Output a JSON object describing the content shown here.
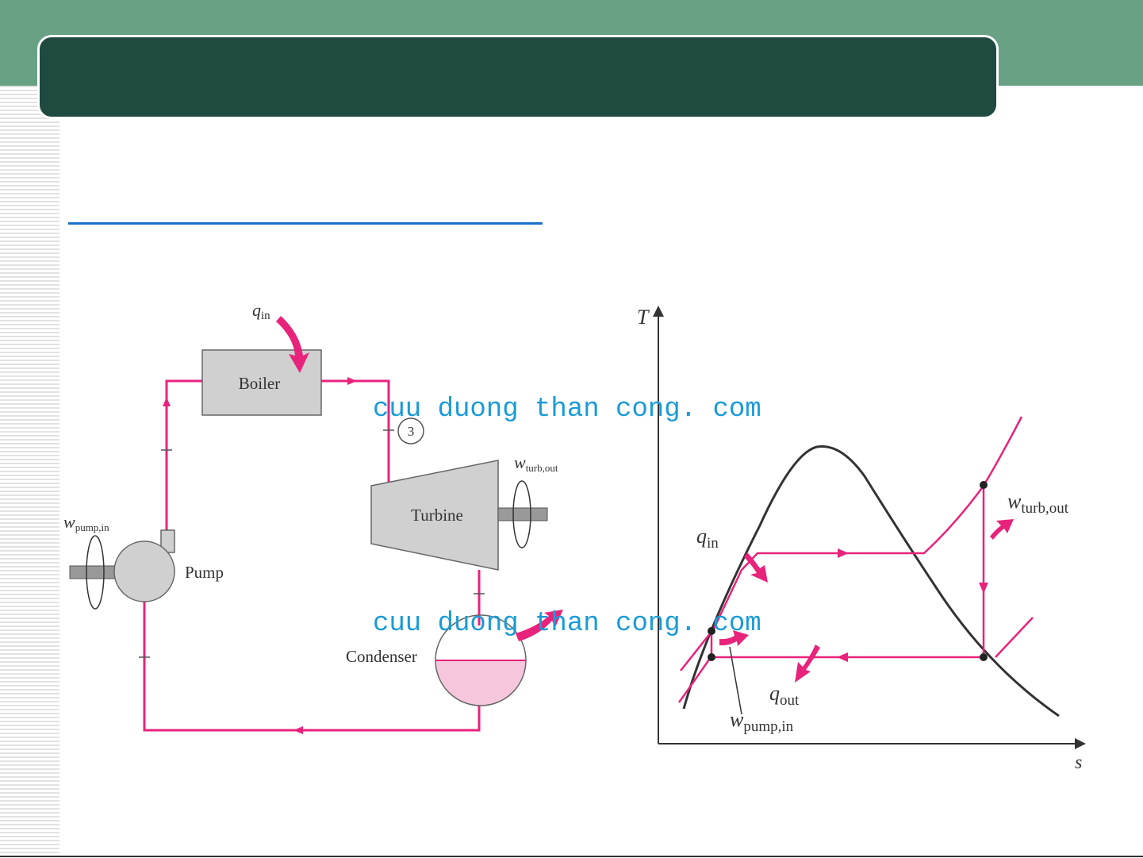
{
  "cycle": {
    "q_in": "q",
    "q_in_sub": "in",
    "boiler": "Boiler",
    "turbine": "Turbine",
    "pump": "Pump",
    "condenser": "Condenser",
    "state_3": "3",
    "w_turb": "w",
    "w_turb_sub": "turb,out",
    "w_pump": "w",
    "w_pump_sub": "pump,in"
  },
  "ts_diagram": {
    "y_axis": "T",
    "x_axis": "s",
    "q_in": "q",
    "q_in_sub": "in",
    "w_turb": "w",
    "w_turb_sub": "turb,out",
    "q_out": "q",
    "q_out_sub": "out",
    "w_pump": "w",
    "w_pump_sub": "pump,in"
  },
  "watermark": {
    "text_1": "cuu duong than cong. com",
    "text_2": "cuu duong than cong. com",
    "color": "#1a9bd8"
  },
  "colors": {
    "header_band": "#68a184",
    "title_box": "#1f4a40",
    "cycle_line": "#e8237c",
    "accent_line": "#1a72c8"
  }
}
